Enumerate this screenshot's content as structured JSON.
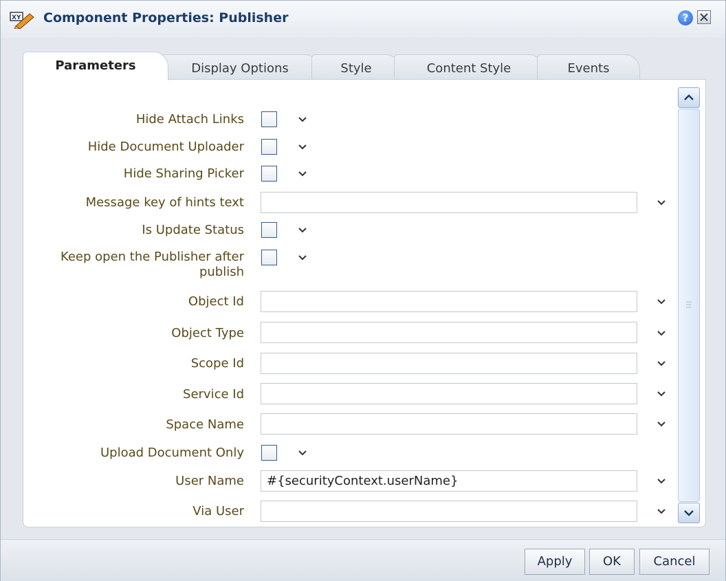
{
  "dialog": {
    "title": "Component Properties: Publisher",
    "title_icon": "xy-pencil-icon",
    "help_icon": "help-icon",
    "help_glyph": "?",
    "close_icon": "close-icon"
  },
  "tabs": [
    {
      "label": "Parameters",
      "active": true
    },
    {
      "label": "Display Options",
      "active": false
    },
    {
      "label": "Style",
      "active": false
    },
    {
      "label": "Content Style",
      "active": false
    },
    {
      "label": "Events",
      "active": false
    }
  ],
  "parameters": [
    {
      "label": "Hide Attach Links",
      "type": "checkbox",
      "checked": false
    },
    {
      "label": "Hide Document Uploader",
      "type": "checkbox",
      "checked": false
    },
    {
      "label": "Hide Sharing Picker",
      "type": "checkbox",
      "checked": false
    },
    {
      "label": "Message key of hints text",
      "type": "text",
      "value": ""
    },
    {
      "label": "Is Update Status",
      "type": "checkbox",
      "checked": false
    },
    {
      "label_line1": "Keep open the Publisher after",
      "label_line2": "publish",
      "type": "checkbox",
      "checked": false
    },
    {
      "label": "Object Id",
      "type": "text",
      "value": ""
    },
    {
      "label": "Object Type",
      "type": "text",
      "value": ""
    },
    {
      "label": "Scope Id",
      "type": "text",
      "value": ""
    },
    {
      "label": "Service Id",
      "type": "text",
      "value": ""
    },
    {
      "label": "Space Name",
      "type": "text",
      "value": ""
    },
    {
      "label": "Upload Document Only",
      "type": "checkbox",
      "checked": false
    },
    {
      "label": "User Name",
      "type": "text",
      "value": "#{securityContext.userName}"
    },
    {
      "label": "Via User",
      "type": "text",
      "value": ""
    }
  ],
  "footer": {
    "apply": "Apply",
    "ok": "OK",
    "cancel": "Cancel"
  },
  "colors": {
    "title": "#1c3d6b",
    "label": "#5a4a1a",
    "checkbox_border": "#335b8a"
  }
}
